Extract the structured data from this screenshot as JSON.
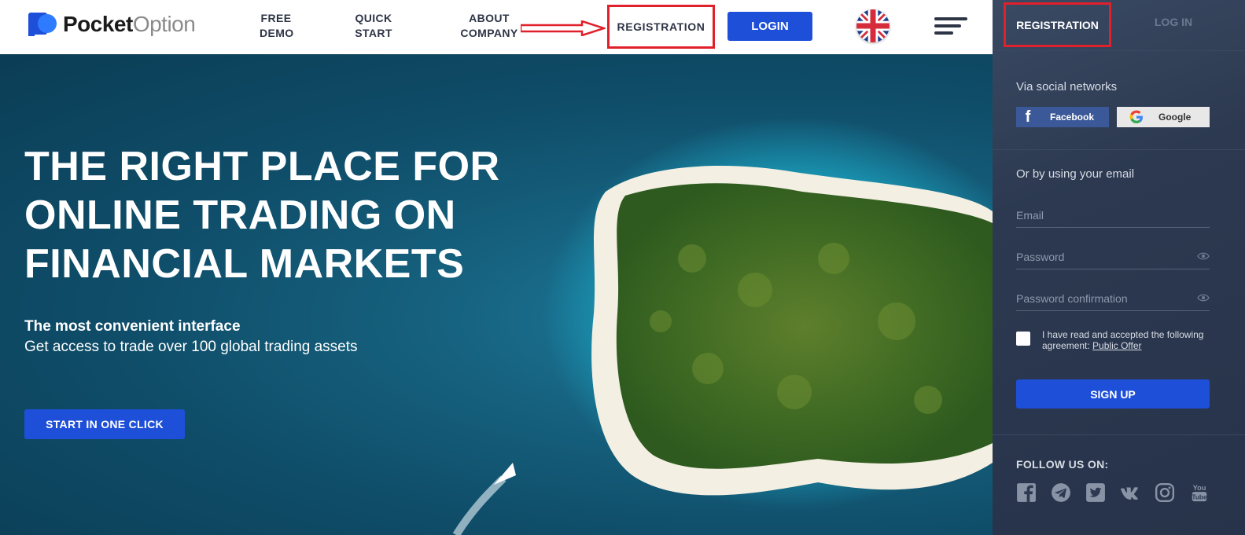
{
  "nav": {
    "logo_bold": "Pocket",
    "logo_light": "Option",
    "links": [
      {
        "line1": "FREE",
        "line2": "DEMO"
      },
      {
        "line1": "QUICK",
        "line2": "START"
      },
      {
        "line1": "ABOUT",
        "line2": "COMPANY"
      }
    ],
    "registration": "REGISTRATION",
    "login": "LOGIN",
    "language_icon": "uk-flag-icon",
    "menu_icon": "hamburger-menu-icon"
  },
  "hero": {
    "title": "THE RIGHT PLACE FOR ONLINE TRADING ON FINANCIAL MARKETS",
    "subtitle_bold": "The most convenient interface",
    "subtitle": "Get access to trade over 100 global trading assets",
    "cta": "START IN ONE CLICK"
  },
  "panel": {
    "tab_registration": "REGISTRATION",
    "tab_login": "LOG IN",
    "via_social": "Via social networks",
    "facebook": "Facebook",
    "google": "Google",
    "or_email": "Or by using your email",
    "email_placeholder": "Email",
    "password_placeholder": "Password",
    "password_confirm_placeholder": "Password confirmation",
    "agree_text": "I have read and accepted the following agreement:",
    "agree_link": "Public Offer",
    "signup": "SIGN UP",
    "follow": "FOLLOW US ON:",
    "social_icons": [
      "facebook-icon",
      "telegram-icon",
      "twitter-icon",
      "vk-icon",
      "instagram-icon",
      "youtube-icon"
    ]
  },
  "colors": {
    "accent_blue": "#1e4fd9",
    "highlight_red": "#e0202b",
    "panel_bg": "#2c3950",
    "nav_text": "#2d3446"
  }
}
